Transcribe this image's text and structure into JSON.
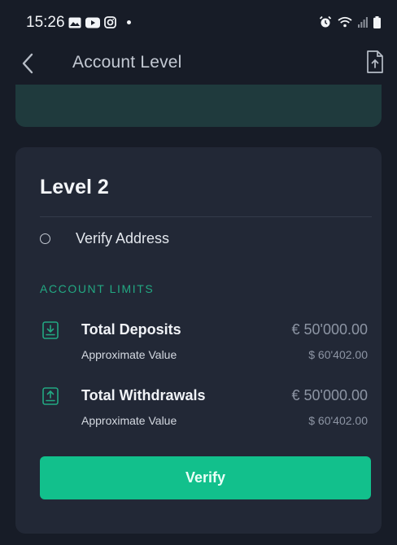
{
  "status_bar": {
    "time": "15:26"
  },
  "header": {
    "title": "Account Level"
  },
  "level": {
    "title": "Level 2",
    "requirements": [
      {
        "label": "Verify Address"
      }
    ]
  },
  "limits": {
    "heading": "ACCOUNT LIMITS",
    "rows": [
      {
        "name": "Total Deposits",
        "value": "€ 50'000.00",
        "approx_label": "Approximate Value",
        "approx_value": "$ 60'402.00",
        "icon": "download-icon"
      },
      {
        "name": "Total Withdrawals",
        "value": "€ 50'000.00",
        "approx_label": "Approximate Value",
        "approx_value": "$ 60'402.00",
        "icon": "upload-icon"
      }
    ]
  },
  "actions": {
    "verify_label": "Verify"
  },
  "colors": {
    "background": "#171c27",
    "card": "#222836",
    "accent": "#12c08c",
    "heading_accent": "#22a882"
  }
}
